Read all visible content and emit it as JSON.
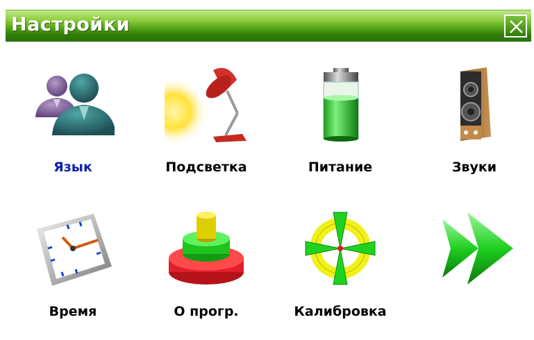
{
  "window": {
    "title": "Настройки",
    "close_icon": "close-icon",
    "accent_color": "#4f9f18"
  },
  "tiles": [
    {
      "label": "Язык",
      "icon": "people-icon",
      "selected": true
    },
    {
      "label": "Подсветка",
      "icon": "desk-lamp-icon",
      "selected": false
    },
    {
      "label": "Питание",
      "icon": "battery-icon",
      "selected": false
    },
    {
      "label": "Звуки",
      "icon": "speaker-icon",
      "selected": false
    },
    {
      "label": "Время",
      "icon": "clock-icon",
      "selected": false
    },
    {
      "label": "О прогр.",
      "icon": "info-stack-icon",
      "selected": false
    },
    {
      "label": "Калибровка",
      "icon": "calibration-target-icon",
      "selected": false
    },
    {
      "label": "",
      "icon": "next-arrow-icon",
      "selected": false
    }
  ],
  "colors": {
    "selected_label": "#0a1fb3",
    "label": "#000000"
  }
}
